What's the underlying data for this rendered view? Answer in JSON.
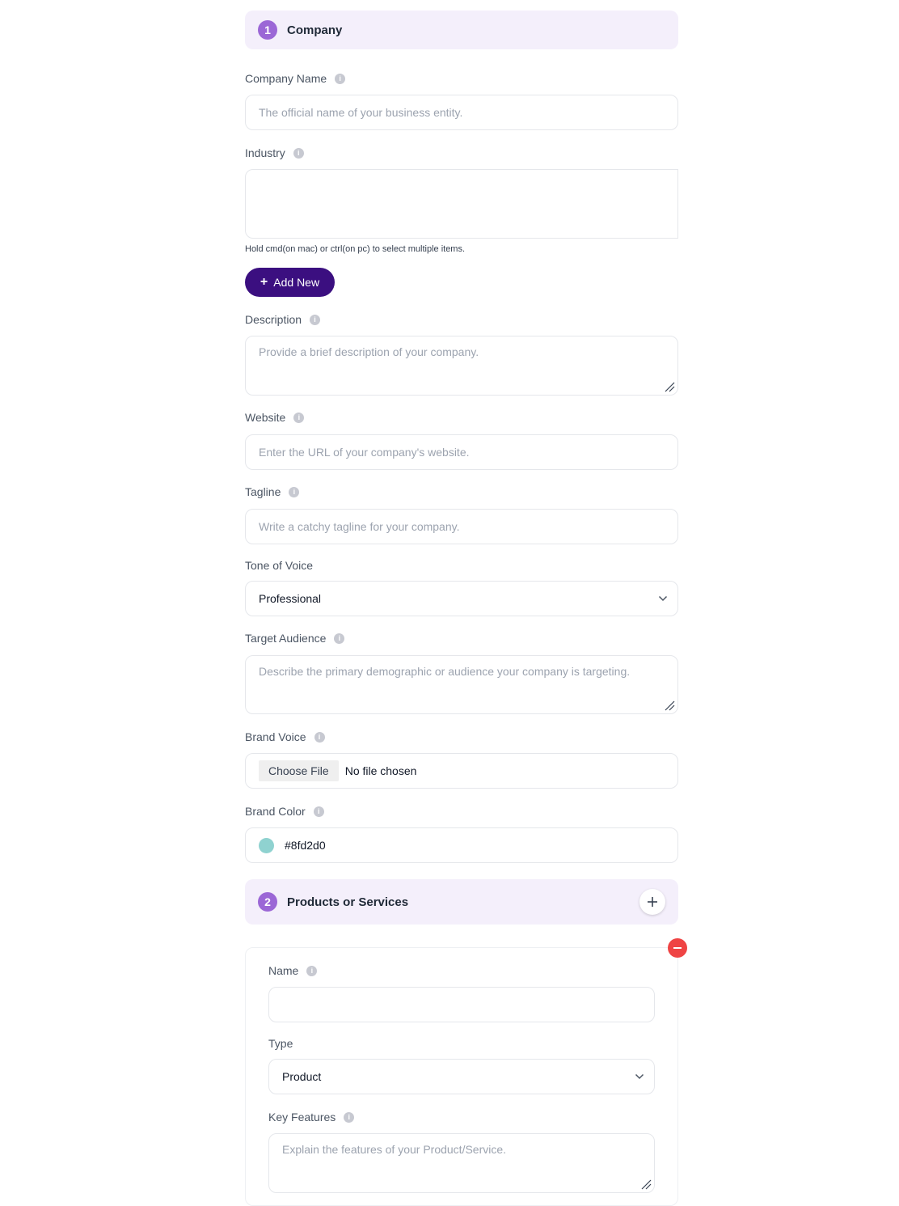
{
  "company_section": {
    "step": "1",
    "title": "Company",
    "fields": {
      "company_name": {
        "label": "Company Name",
        "placeholder": "The official name of your business entity."
      },
      "industry": {
        "label": "Industry",
        "hint": "Hold cmd(on mac) or ctrl(on pc) to select multiple items."
      },
      "add_new_label": "Add New",
      "description": {
        "label": "Description",
        "placeholder": "Provide a brief description of your company."
      },
      "website": {
        "label": "Website",
        "placeholder": "Enter the URL of your company's website."
      },
      "tagline": {
        "label": "Tagline",
        "placeholder": "Write a catchy tagline for your company."
      },
      "tone_of_voice": {
        "label": "Tone of Voice",
        "value": "Professional"
      },
      "target_audience": {
        "label": "Target Audience",
        "placeholder": "Describe the primary demographic or audience your company is targeting."
      },
      "brand_voice": {
        "label": "Brand Voice",
        "button_label": "Choose File",
        "status": "No file chosen"
      },
      "brand_color": {
        "label": "Brand Color",
        "value": "#8fd2d0"
      }
    }
  },
  "products_section": {
    "step": "2",
    "title": "Products or Services",
    "item": {
      "name": {
        "label": "Name",
        "value": ""
      },
      "type": {
        "label": "Type",
        "value": "Product"
      },
      "key_features": {
        "label": "Key Features",
        "placeholder": "Explain the features of your Product/Service."
      }
    }
  },
  "colors": {
    "accent": "#9b67d6",
    "primary_button": "#3b0f80",
    "header_bg": "#f4effb",
    "danger": "#ef4444",
    "brand_swatch": "#8fd2d0"
  },
  "icons": {
    "info": "info-icon",
    "add": "plus-icon",
    "remove": "minus-icon",
    "select": "chevron-down-icon"
  }
}
